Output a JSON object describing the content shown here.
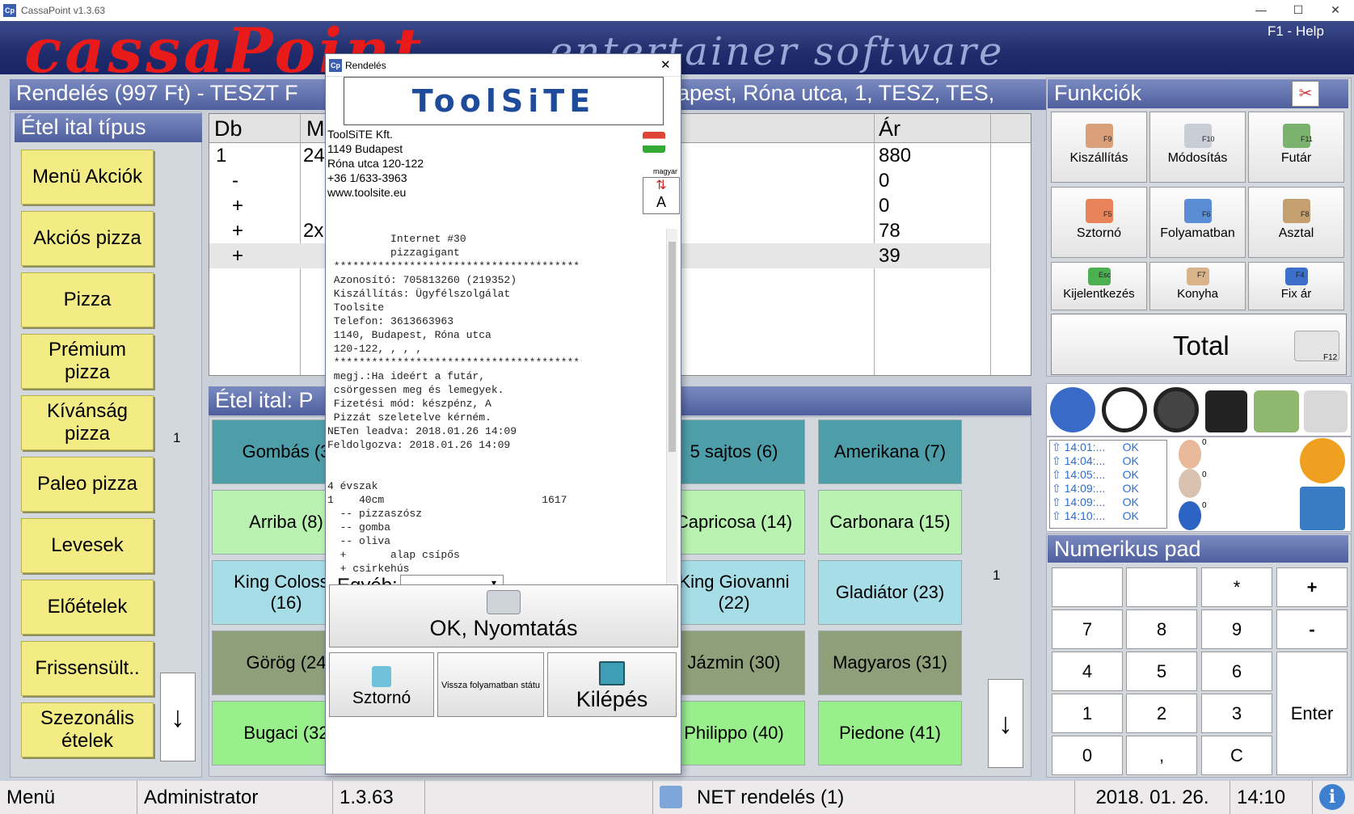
{
  "window": {
    "title": "CassaPoint v1.3.63",
    "min": "—",
    "max": "☐",
    "close": "✕"
  },
  "banner": {
    "brand": "cassaPoint",
    "tagline": "entertainer software",
    "help": "F1 - Help"
  },
  "order_header": {
    "title": "Rendelés (997 Ft)  -  TESZT F",
    "address": "apest, Róna utca, 1, TESZ, TES,"
  },
  "categories": {
    "title": "Étel ital típus",
    "items": [
      "Menü Akciók",
      "Akciós pizza",
      "Pizza",
      "Prémium pizza",
      "Kívánság pizza",
      "Paleo pizza",
      "Levesek",
      "Előételek",
      "Frissensült..",
      "Szezonális ételek"
    ],
    "page": "1",
    "scroll": "↓"
  },
  "order_table": {
    "col_db": "Db",
    "col_m": "M",
    "col_ar": "Ár",
    "rows": [
      {
        "db": "1",
        "m": "24",
        "ar": "880"
      },
      {
        "db": "-",
        "m": "",
        "ar": "0"
      },
      {
        "db": "+",
        "m": "",
        "ar": "0"
      },
      {
        "db": "+",
        "m": "2x",
        "ar": "78"
      },
      {
        "db": "+",
        "m": "",
        "ar": "39"
      }
    ]
  },
  "items": {
    "title": "Étel ital:  P",
    "page": "1",
    "scroll": "↓",
    "grid": [
      {
        "label": "Gombás (3",
        "color": "teal"
      },
      {
        "label": "5 sajtos (6)",
        "color": "teal"
      },
      {
        "label": "Amerikana (7)",
        "color": "teal"
      },
      {
        "label": "Arriba (8)",
        "color": "lgreen"
      },
      {
        "label": "Capricosa (14)",
        "color": "lgreen"
      },
      {
        "label": "Carbonara (15)",
        "color": "lgreen"
      },
      {
        "label": "King Colosse (16)",
        "color": "lblue"
      },
      {
        "label": "King Giovanni (22)",
        "color": "lblue"
      },
      {
        "label": "Gladiátor (23)",
        "color": "lblue"
      },
      {
        "label": "Görög (24",
        "color": "olive"
      },
      {
        "label": "Jázmin (30)",
        "color": "olive"
      },
      {
        "label": "Magyaros (31)",
        "color": "olive"
      },
      {
        "label": "Bugaci (32",
        "color": "green"
      },
      {
        "label": "Philippo (40)",
        "color": "green"
      },
      {
        "label": "Piedone (41)",
        "color": "green"
      }
    ]
  },
  "functions": {
    "title": "Funkciók",
    "buttons": [
      {
        "label": "Kiszállítás",
        "key": "F9"
      },
      {
        "label": "Módosítás",
        "key": "F10"
      },
      {
        "label": "Futár",
        "key": "F11"
      },
      {
        "label": "Sztornó",
        "key": "F5"
      },
      {
        "label": "Folyamatban",
        "key": "F6"
      },
      {
        "label": "Asztal",
        "key": "F8"
      },
      {
        "label": "Kijelentkezés",
        "key": "Esc"
      },
      {
        "label": "Konyha",
        "key": "F7"
      },
      {
        "label": "Fix ár",
        "key": "F4"
      }
    ],
    "total": "Total",
    "total_key": "F12"
  },
  "log": [
    {
      "time": "14:01:...",
      "status": "OK"
    },
    {
      "time": "14:04:...",
      "status": "OK"
    },
    {
      "time": "14:05:...",
      "status": "OK"
    },
    {
      "time": "14:09:...",
      "status": "OK"
    },
    {
      "time": "14:09:...",
      "status": "OK"
    },
    {
      "time": "14:10:...",
      "status": "OK"
    }
  ],
  "log_counts": [
    "0",
    "0",
    "0"
  ],
  "numpad": {
    "title": "Numerikus pad",
    "keys": [
      "*",
      "+",
      "7",
      "8",
      "9",
      "-",
      "4",
      "5",
      "6",
      "Enter",
      "1",
      "2",
      "3",
      "0",
      ",",
      "C"
    ]
  },
  "status": {
    "menu": "Menü",
    "user": "Administrator",
    "version": "1.3.63",
    "net": "NET rendelés (1)",
    "date": "2018. 01. 26.",
    "time": "14:10"
  },
  "modal": {
    "title": "Rendelés",
    "close": "✕",
    "logo": "ToolSiTE",
    "company": "ToolSiTE Kft.",
    "zip": "1149 Budapest",
    "street": "Róna utca 120-122",
    "phone": "+36 1/633-3963",
    "web": "www.toolsite.eu",
    "lang": "magyar",
    "lang_btn": "A",
    "receipt": "          Internet #30\n          pizzagigant\n ***************************************\n Azonosító: 705813260 (219352)\n Kiszállítás: Ügyfélszolgálat\n Toolsite\n Telefon: 3613663963\n 1140, Budapest, Róna utca\n 120-122, , , ,\n ***************************************\n megj.:Ha ideért a futár,\n csörgessen meg és lemegyek.\n Fizetési mód: készpénz, A\n Pizzát szeletelve kérném.\nNETen leadva: 2018.01.26 14:09\nFeldolgozva: 2018.01.26 14:09\n\n\n4 évszak\n1    40cm                         1617\n  -- pizzaszósz\n  -- gomba\n  -- oliva\n  +       alap csípős\n  + csirkehús",
    "other_label": "Egyéb:",
    "ok": "OK, Nyomtatás",
    "storno": "Sztornó",
    "back": "Vissza folyamatban státu",
    "exit": "Kilépés"
  },
  "colors": {
    "teal": "#4d9ea9",
    "lgreen": "#b9f2b1",
    "lblue": "#a6dde6",
    "olive": "#8e9f79",
    "green": "#99ef8c"
  }
}
